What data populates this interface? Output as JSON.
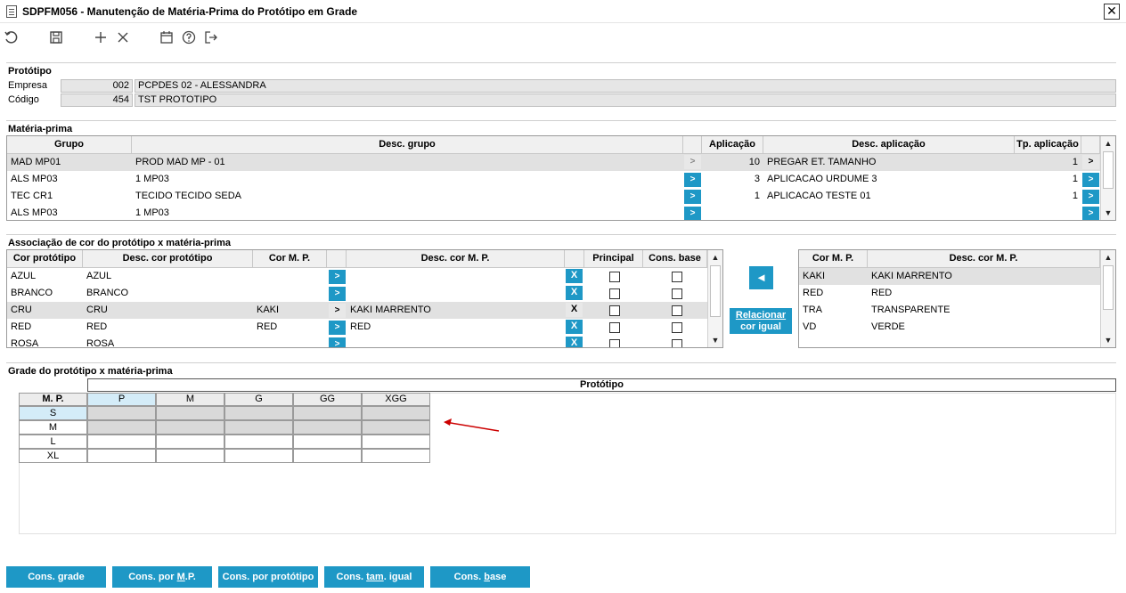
{
  "window": {
    "title": "SDPFM056 - Manutenção de Matéria-Prima do Protótipo em Grade",
    "close_label": "✕"
  },
  "toolbar": {
    "icons": [
      "undo-icon",
      "save-icon",
      "add-icon",
      "delete-icon",
      "calendar-icon",
      "help-icon",
      "exit-icon"
    ]
  },
  "prototipo": {
    "title": "Protótipo",
    "empresa_label": "Empresa",
    "empresa_code": "002",
    "empresa_name": "PCPDES 02 - ALESSANDRA",
    "codigo_label": "Código",
    "codigo_code": "454",
    "codigo_name": "TST PROTOTIPO"
  },
  "materia": {
    "title": "Matéria-prima",
    "headers": {
      "grupo": "Grupo",
      "desc_grupo": "Desc. grupo",
      "aplicacao": "Aplicação",
      "desc_aplicacao": "Desc. aplicação",
      "tp_aplicacao": "Tp. aplicação"
    },
    "rows": [
      {
        "grupo": "MAD MP01",
        "desc": "PROD MAD MP - 01",
        "btn": ">",
        "aplic": "10",
        "desc_aplic": "PREGAR ET. TAMANHO",
        "tp": "1",
        "btn2": ">"
      },
      {
        "grupo": "ALS MP03",
        "desc": "1 MP03",
        "btn": ">",
        "aplic": "3",
        "desc_aplic": "APLICACAO URDUME 3",
        "tp": "1",
        "btn2": ">"
      },
      {
        "grupo": "TEC CR1",
        "desc": "TECIDO TECIDO SEDA",
        "btn": ">",
        "aplic": "1",
        "desc_aplic": "APLICACAO TESTE 01",
        "tp": "1",
        "btn2": ">"
      },
      {
        "grupo": "ALS MP03",
        "desc": "1 MP03",
        "btn": ">",
        "aplic": "",
        "desc_aplic": "",
        "tp": "",
        "btn2": ">"
      }
    ]
  },
  "associacao": {
    "title": "Associação de cor do protótipo x matéria-prima",
    "headers": {
      "cor_prot": "Cor protótipo",
      "desc_cor_prot": "Desc. cor protótipo",
      "cor_mp": "Cor M. P.",
      "desc_cor_mp": "Desc. cor M. P.",
      "principal": "Principal",
      "cons_base": "Cons. base"
    },
    "rows": [
      {
        "cor": "AZUL",
        "desc": "AZUL",
        "cor_mp": "",
        "desc_mp": "",
        "go": ">",
        "x": "X"
      },
      {
        "cor": "BRANCO",
        "desc": "BRANCO",
        "cor_mp": "",
        "desc_mp": "",
        "go": ">",
        "x": "X"
      },
      {
        "cor": "CRU",
        "desc": "CRU",
        "cor_mp": "KAKI",
        "desc_mp": "KAKI MARRENTO",
        "go": ">",
        "x": "X"
      },
      {
        "cor": "RED",
        "desc": "RED",
        "cor_mp": "RED",
        "desc_mp": "RED",
        "go": ">",
        "x": "X"
      },
      {
        "cor": "ROSA",
        "desc": "ROSA",
        "cor_mp": "",
        "desc_mp": "",
        "go": ">",
        "x": "X"
      }
    ],
    "arrow_label": "◄",
    "relacionar_line1": "Relacionar",
    "relacionar_line2": "cor igual",
    "right_headers": {
      "cor_mp": "Cor M. P.",
      "desc_cor_mp": "Desc. cor M. P."
    },
    "right_rows": [
      {
        "cor": "KAKI",
        "desc": "KAKI MARRENTO"
      },
      {
        "cor": "RED",
        "desc": "RED"
      },
      {
        "cor": "TRA",
        "desc": "TRANSPARENTE"
      },
      {
        "cor": "VD",
        "desc": "VERDE"
      }
    ]
  },
  "grade": {
    "title": "Grade do protótipo x matéria-prima",
    "header_prototipo": "Protótipo",
    "corner": "M. P.",
    "cols": [
      "P",
      "M",
      "G",
      "GG",
      "XGG"
    ],
    "rows": [
      "S",
      "M",
      "L",
      "XL"
    ]
  },
  "buttons": {
    "cons_grade": "Cons. grade",
    "cons_mp_pre": "Cons. por ",
    "cons_mp_u": "M",
    "cons_mp_post": ".P.",
    "cons_prot": "Cons. por protótipo",
    "cons_tam_pre": "Cons. ",
    "cons_tam_u": "tam",
    "cons_tam_post": ". igual",
    "cons_base_pre": "Cons. ",
    "cons_base_u": "b",
    "cons_base_post": "ase"
  },
  "colors": {
    "accent": "#1e98c6",
    "selected_row": "#e1e1e1",
    "grid_gray": "#d9d9d9",
    "arrow": "#cc0000"
  }
}
